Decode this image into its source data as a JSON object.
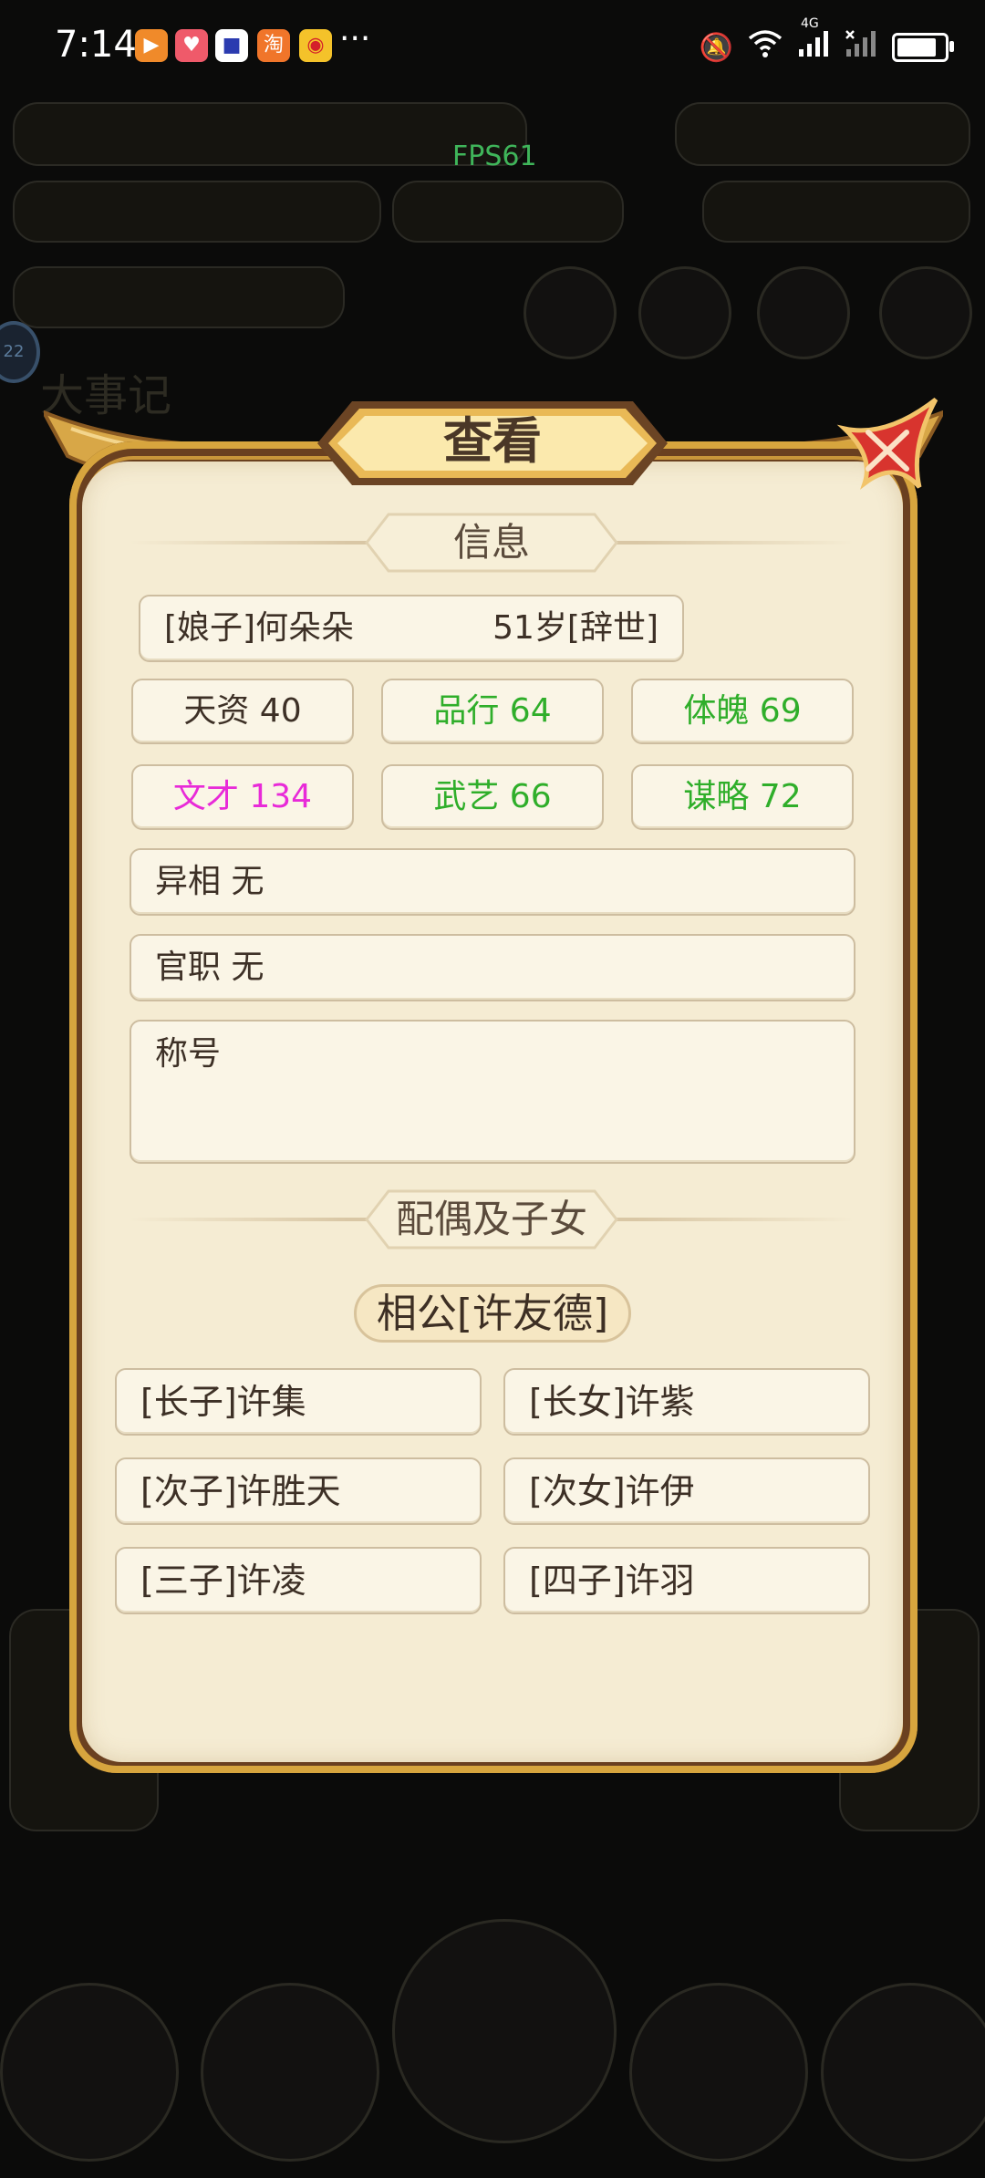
{
  "status_bar": {
    "time": "7:14",
    "apps": [
      "video-app-icon",
      "shopping-app-icon",
      "post-app-icon",
      "taobao-icon",
      "weibo-icon"
    ],
    "more": "···",
    "network": "4G",
    "battery_fill": 0.75
  },
  "background": {
    "fps": "FPS61",
    "side_badge": "22",
    "title_text": "大事记"
  },
  "dialog": {
    "title": "查看",
    "info_header": "信息",
    "person": {
      "name": "[娘子]何朵朵",
      "age": "51岁[辞世]"
    },
    "stats": [
      {
        "label": "天资 40",
        "color": "#3d3026"
      },
      {
        "label": "品行 64",
        "color": "#2fae2a"
      },
      {
        "label": "体魄 69",
        "color": "#2fae2a"
      },
      {
        "label": "文才 134",
        "color": "#e82ad8"
      },
      {
        "label": "武艺 66",
        "color": "#2fae2a"
      },
      {
        "label": "谋略 72",
        "color": "#2fae2a"
      }
    ],
    "traits": "异相 无",
    "office": "官职 无",
    "title_field": "称号",
    "family_header": "配偶及子女",
    "spouse": "相公[许友德]",
    "children": [
      "[长子]许集",
      "[长女]许紫",
      "[次子]许胜天",
      "[次女]许伊",
      "[三子]许凌",
      "[四子]许羽"
    ]
  }
}
